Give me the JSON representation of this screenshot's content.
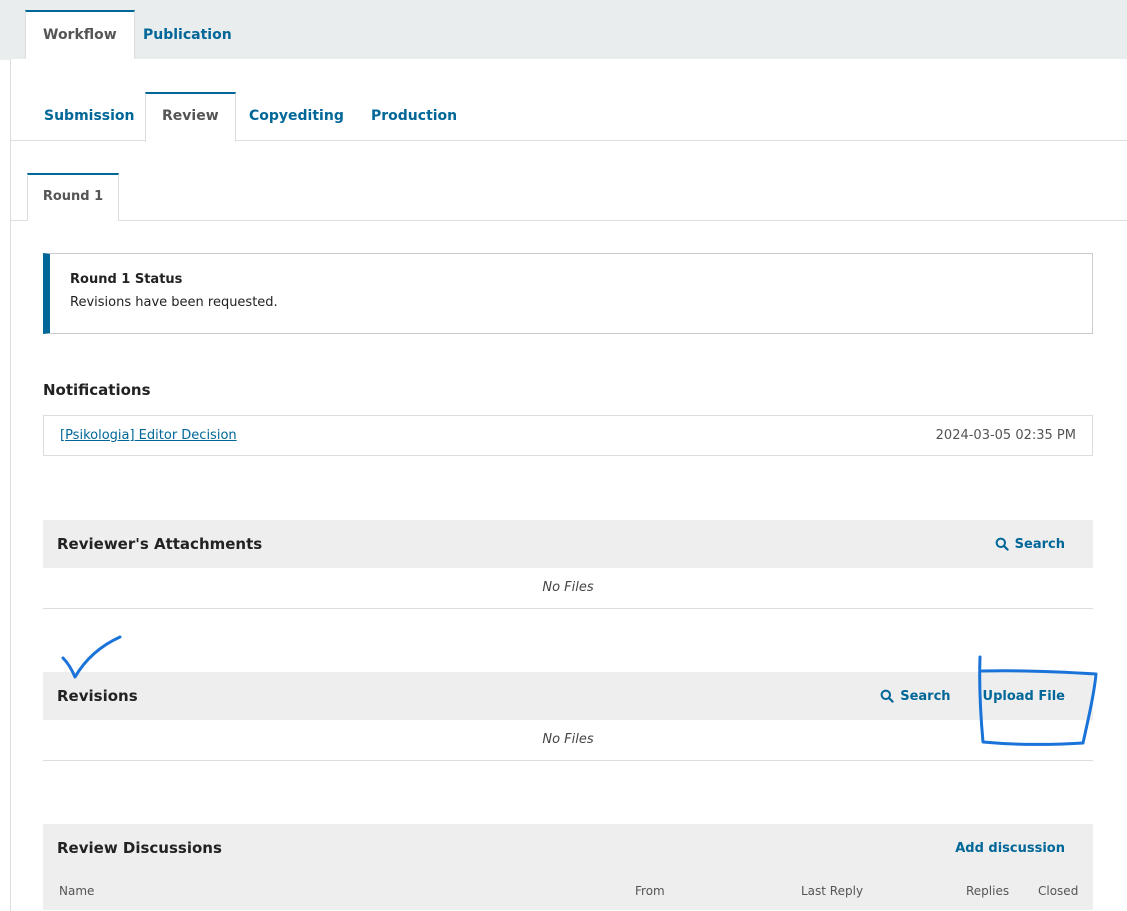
{
  "top_tabs": [
    {
      "label": "Workflow",
      "active": true
    },
    {
      "label": "Publication",
      "active": false
    }
  ],
  "stage_tabs": [
    {
      "label": "Submission",
      "active": false
    },
    {
      "label": "Review",
      "active": true
    },
    {
      "label": "Copyediting",
      "active": false
    },
    {
      "label": "Production",
      "active": false
    }
  ],
  "round_tab": {
    "label": "Round 1"
  },
  "status": {
    "title": "Round 1 Status",
    "text": "Revisions have been requested."
  },
  "notifications": {
    "heading": "Notifications",
    "items": [
      {
        "link": "[Psikologia] Editor Decision",
        "time": "2024-03-05 02:35 PM"
      }
    ]
  },
  "reviewer_attachments": {
    "title": "Reviewer's Attachments",
    "search_label": "Search",
    "empty_text": "No Files"
  },
  "revisions": {
    "title": "Revisions",
    "search_label": "Search",
    "upload_label": "Upload File",
    "empty_text": "No Files"
  },
  "review_discussions": {
    "title": "Review Discussions",
    "add_label": "Add discussion",
    "columns": [
      "Name",
      "From",
      "Last Reply",
      "Replies",
      "Closed"
    ]
  },
  "colors": {
    "accent": "#006798",
    "annotation": "#1a73d9",
    "grid_header_bg": "#eeeeee"
  }
}
